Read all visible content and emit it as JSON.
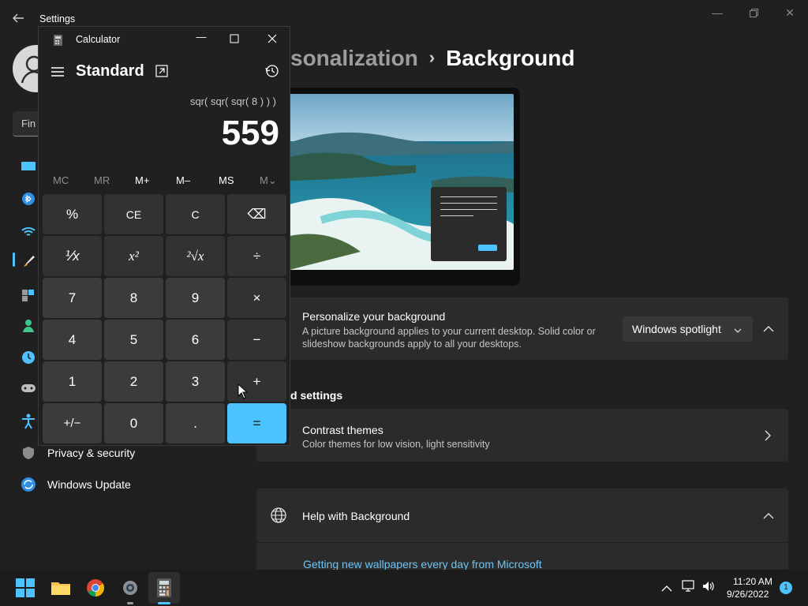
{
  "settings": {
    "title": "Settings",
    "search_partial": "Fin",
    "breadcrumb_parent": "sonalization",
    "breadcrumb_sep": "›",
    "breadcrumb_current": "Background",
    "personalize": {
      "title": "Personalize your background",
      "desc1": "A picture background applies to your current desktop. Solid color or",
      "desc2": "slideshow backgrounds apply to all your desktops.",
      "dropdown_value": "Windows spotlight"
    },
    "related_settings_partial": "d settings",
    "contrast": {
      "title": "Contrast themes",
      "desc": "Color themes for low vision, light sensitivity"
    },
    "help": {
      "title": "Help with Background",
      "link": "Getting new wallpapers every day from Microsoft"
    },
    "sidebar": {
      "privacy": "Privacy & security",
      "update": "Windows Update"
    }
  },
  "calculator": {
    "title": "Calculator",
    "mode": "Standard",
    "expression": "sqr( sqr( sqr( 8 ) ) )",
    "display": "559",
    "memory": [
      "MC",
      "MR",
      "M+",
      "M–",
      "MS",
      "M⌄"
    ],
    "keys": [
      [
        "%",
        "CE",
        "C",
        "⌫"
      ],
      [
        "⅟x",
        "x²",
        "²√x",
        "÷"
      ],
      [
        "7",
        "8",
        "9",
        "×"
      ],
      [
        "4",
        "5",
        "6",
        "−"
      ],
      [
        "1",
        "2",
        "3",
        "+"
      ],
      [
        "+/−",
        "0",
        ".",
        "="
      ]
    ]
  },
  "taskbar": {
    "time": "11:20 AM",
    "date": "9/26/2022",
    "notification_count": "1"
  },
  "colors": {
    "accent": "#4cc2ff",
    "background": "#202020",
    "card": "#2b2b2b"
  }
}
